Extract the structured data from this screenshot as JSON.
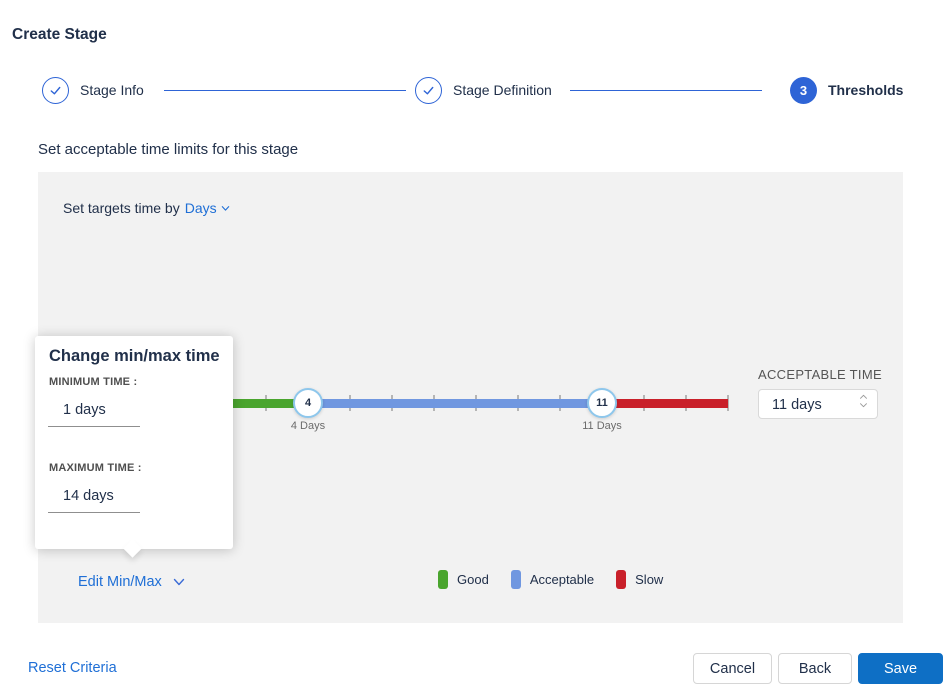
{
  "page": {
    "title": "Create Stage",
    "section_heading": "Set acceptable time limits for this stage"
  },
  "stepper": {
    "steps": [
      {
        "label": "Stage Info",
        "state": "complete"
      },
      {
        "label": "Stage Definition",
        "state": "complete"
      },
      {
        "label": "Thresholds",
        "state": "current",
        "number": "3"
      }
    ]
  },
  "panel": {
    "set_targets_label": "Set targets time by",
    "unit_dropdown_value": "Days",
    "acceptable_time_label": "ACCEPTABLE TIME",
    "acceptable_time_value": "11 days",
    "edit_minmax_label": "Edit Min/Max"
  },
  "slider": {
    "min_day": 1,
    "max_day": 14,
    "handles": [
      {
        "value": "4",
        "label": "4 Days"
      },
      {
        "value": "11",
        "label": "11 Days"
      }
    ],
    "segments": [
      {
        "name": "Good",
        "color": "#4aa52e"
      },
      {
        "name": "Acceptable",
        "color": "#7097e0"
      },
      {
        "name": "Slow",
        "color": "#c9202a"
      }
    ]
  },
  "legend": [
    {
      "label": "Good",
      "color": "#4aa52e"
    },
    {
      "label": "Acceptable",
      "color": "#7097e0"
    },
    {
      "label": "Slow",
      "color": "#c9202a"
    }
  ],
  "popover": {
    "title": "Change min/max time",
    "minimum_label": "MINIMUM TIME :",
    "minimum_value": "1 days",
    "maximum_label": "MAXIMUM TIME :",
    "maximum_value": "14 days"
  },
  "footer": {
    "reset_label": "Reset Criteria",
    "cancel_label": "Cancel",
    "back_label": "Back",
    "save_label": "Save"
  },
  "colors": {
    "accent_blue": "#2e64d6",
    "link_blue": "#1f6fd6",
    "save_blue": "#0e6fc5",
    "good_green": "#4aa52e",
    "acceptable_blue": "#7097e0",
    "slow_red": "#c9202a",
    "panel_gray": "#f2f2f2"
  }
}
